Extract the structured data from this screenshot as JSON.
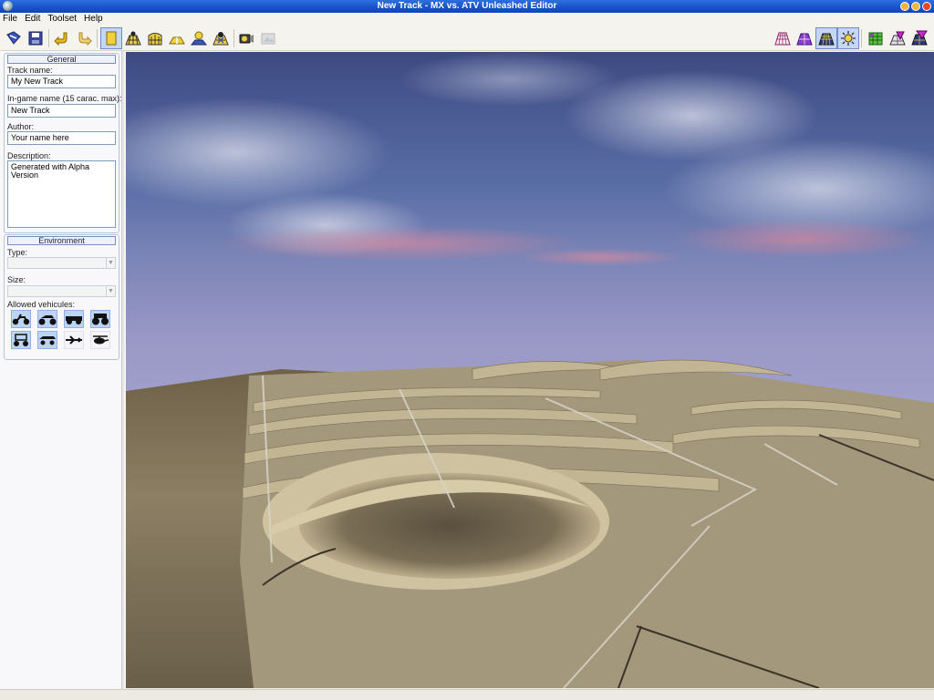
{
  "window": {
    "title": "New Track - MX vs. ATV Unleashed Editor"
  },
  "menu": {
    "items": [
      "File",
      "Edit",
      "Toolset",
      "Help"
    ]
  },
  "toolbar": {
    "left_icons": [
      "open-icon",
      "save-icon",
      "undo-icon",
      "redo-icon",
      "select-tool-icon",
      "terrain-tool-icon",
      "ramp-tool-icon",
      "path-tool-icon",
      "light-tool-icon",
      "object-tool-icon",
      "camera-icon",
      "render-icon"
    ],
    "right_icons": [
      "grid-view-icon",
      "wireframe-view-icon",
      "textured-view-icon",
      "lighting-view-icon",
      "grid-overlay-icon",
      "object-overlay-icon",
      "vehicle-overlay-icon"
    ],
    "active": [
      "select-tool-icon",
      "textured-view-icon",
      "lighting-view-icon"
    ]
  },
  "general": {
    "header": "General",
    "track_name_label": "Track name:",
    "track_name_value": "My New Track",
    "ingame_name_label": "In-game name (15 carac. max):",
    "ingame_name_value": "New Track",
    "author_label": "Author:",
    "author_value": "Your name here",
    "description_label": "Description:",
    "description_value": "Generated with Alpha Version"
  },
  "environment": {
    "header": "Environment",
    "type_label": "Type:",
    "type_value": "",
    "size_label": "Size:",
    "size_value": "",
    "vehicles_label": "Allowed vehicules:",
    "vehicles": [
      {
        "icon": "dirtbike-icon",
        "allowed": true
      },
      {
        "icon": "atv-icon",
        "allowed": true
      },
      {
        "icon": "truck-icon",
        "allowed": true
      },
      {
        "icon": "monster-truck-icon",
        "allowed": true
      },
      {
        "icon": "buggy-icon",
        "allowed": true
      },
      {
        "icon": "golf-cart-icon",
        "allowed": true
      },
      {
        "icon": "plane-icon",
        "allowed": false
      },
      {
        "icon": "helicopter-icon",
        "allowed": false
      }
    ]
  },
  "colors": {
    "titlebar": "#1552c8",
    "active_button": "#c6d6f0",
    "vehicle_allowed": "#bcd4f4"
  }
}
